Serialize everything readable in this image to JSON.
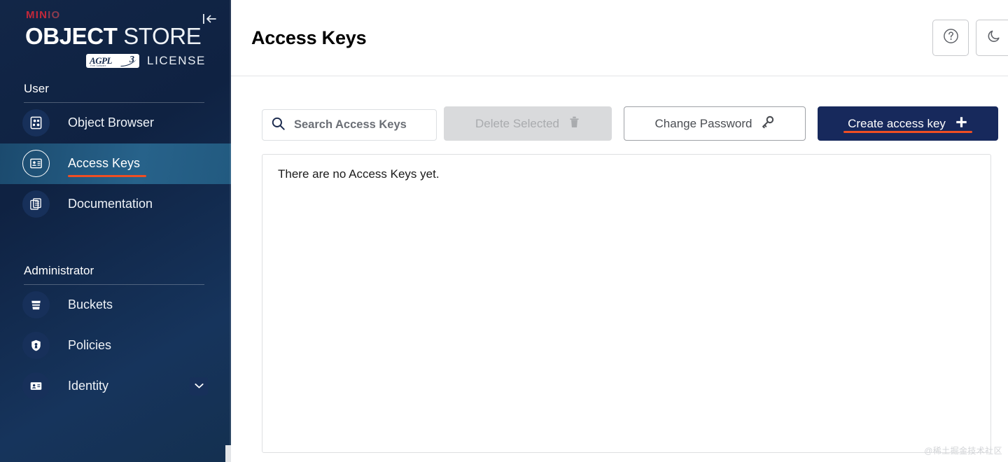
{
  "brand": {
    "minio_bold": "MIN",
    "minio_light": "IO",
    "object": "OBJECT",
    "store": " STORE",
    "agpl_label": "AGPL",
    "agpl_sub": "Free Software",
    "agpl_version": "3",
    "license_text": "LICENSE",
    "collapse_icon": "collapse-sidebar-icon"
  },
  "sidebar": {
    "sections": [
      {
        "label": "User",
        "items": [
          {
            "label": "Object Browser",
            "icon": "object-browser-icon",
            "active": false,
            "expandable": false
          },
          {
            "label": "Access Keys",
            "icon": "access-keys-icon",
            "active": true,
            "expandable": false
          },
          {
            "label": "Documentation",
            "icon": "documentation-icon",
            "active": false,
            "expandable": false
          }
        ]
      },
      {
        "label": "Administrator",
        "items": [
          {
            "label": "Buckets",
            "icon": "buckets-icon",
            "active": false,
            "expandable": false
          },
          {
            "label": "Policies",
            "icon": "policies-icon",
            "active": false,
            "expandable": false
          },
          {
            "label": "Identity",
            "icon": "identity-icon",
            "active": false,
            "expandable": true
          }
        ]
      }
    ]
  },
  "header": {
    "title": "Access Keys",
    "help_icon": "help-circle-icon",
    "theme_icon": "moon-icon"
  },
  "toolbar": {
    "search_placeholder": "Search Access Keys",
    "search_value": "",
    "search_icon": "search-icon",
    "delete_label": "Delete Selected",
    "delete_icon": "trash-icon",
    "delete_disabled": true,
    "change_password_label": "Change Password",
    "change_password_icon": "key-icon",
    "create_label": "Create access key",
    "create_icon": "plus-icon"
  },
  "main": {
    "empty_message": "There are no Access Keys yet."
  },
  "watermark": "@稀土掘金技术社区",
  "colors": {
    "sidebar_bg": "#122647",
    "active_item_bg": "#24618a",
    "accent_orange": "#f04e23",
    "brand_red": "#c3283a",
    "primary_navy": "#17295c"
  }
}
